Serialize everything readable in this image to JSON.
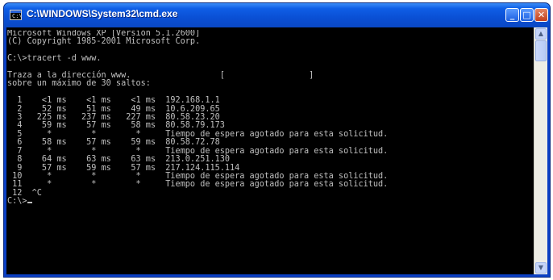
{
  "window": {
    "title": "C:\\WINDOWS\\System32\\cmd.exe",
    "icon": "cmd-icon",
    "controls": {
      "minimize": "_",
      "maximize": "□",
      "close": "✕"
    }
  },
  "console": {
    "lines": [
      "Microsoft Windows XP [Versión 5.1.2600]",
      "(C) Copyright 1985-2001 Microsoft Corp.",
      "",
      "C:\\>tracert -d www.",
      "",
      "Traza a la dirección www.                  [                 ]",
      "sobre un máximo de 30 saltos:",
      "",
      "  1    <1 ms    <1 ms    <1 ms  192.168.1.1",
      "  2    52 ms    51 ms    49 ms  10.6.209.65",
      "  3   225 ms   237 ms   227 ms  80.58.23.20",
      "  4    59 ms    57 ms    58 ms  80.58.79.173",
      "  5     *        *        *     Tiempo de espera agotado para esta solicitud.",
      "  6    58 ms    57 ms    59 ms  80.58.72.78",
      "  7     *        *        *     Tiempo de espera agotado para esta solicitud.",
      "  8    64 ms    63 ms    63 ms  213.0.251.130",
      "  9    57 ms    59 ms    57 ms  217.124.115.114",
      " 10     *        *        *     Tiempo de espera agotado para esta solicitud.",
      " 11     *        *        *     Tiempo de espera agotado para esta solicitud.",
      " 12  ^C"
    ],
    "prompt": "C:\\>"
  },
  "scrollbar": {
    "up": "▲",
    "down": "▼"
  },
  "colors": {
    "titlebar": "#0a4fd4",
    "console_background": "#000000",
    "console_text": "#c0c0c0",
    "close_button": "#c2401c"
  }
}
